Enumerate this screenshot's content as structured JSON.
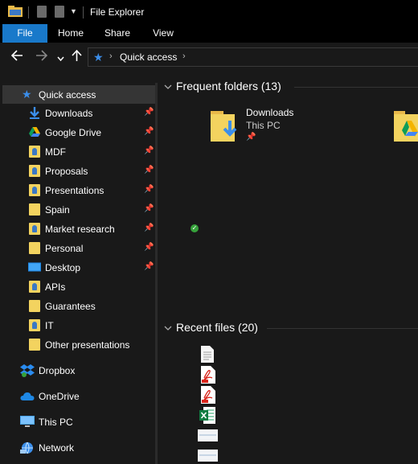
{
  "window": {
    "title": "File Explorer"
  },
  "ribbon": {
    "tabs": [
      "File",
      "Home",
      "Share",
      "View"
    ]
  },
  "address": {
    "crumb": "Quick access"
  },
  "nav": {
    "quick_access": "Quick access",
    "items": [
      {
        "label": "Downloads",
        "pinned": true
      },
      {
        "label": "Google Drive",
        "pinned": true
      },
      {
        "label": "MDF",
        "pinned": true
      },
      {
        "label": "Proposals",
        "pinned": true
      },
      {
        "label": "Presentations",
        "pinned": true
      },
      {
        "label": "Spain",
        "pinned": true
      },
      {
        "label": "Market research",
        "pinned": true
      },
      {
        "label": "Personal",
        "pinned": true
      },
      {
        "label": "Desktop",
        "pinned": true
      },
      {
        "label": "APIs",
        "pinned": false
      },
      {
        "label": "Guarantees",
        "pinned": false
      },
      {
        "label": "IT",
        "pinned": false
      },
      {
        "label": "Other presentations",
        "pinned": false
      }
    ],
    "roots": [
      "Dropbox",
      "OneDrive",
      "This PC",
      "Network"
    ]
  },
  "main": {
    "frequent_header": "Frequent folders (13)",
    "frequent": [
      {
        "name": "Downloads",
        "location": "This PC"
      }
    ],
    "recent_header": "Recent files (20)"
  },
  "icons": {
    "pin": "pin-icon",
    "quick_access": "star-icon",
    "back": "arrow-left-icon",
    "forward": "arrow-right-icon",
    "recent": "chevron-down-icon",
    "up": "arrow-up-icon"
  },
  "colors": {
    "accent": "#1979ca",
    "folder": "#f3d35f",
    "star": "#3b8eea",
    "sync_ok": "#36a23b"
  }
}
